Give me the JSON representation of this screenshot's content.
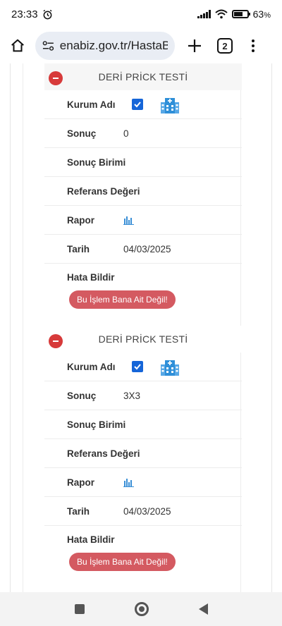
{
  "status_bar": {
    "time": "23:33",
    "battery": "63",
    "battery_unit": "%"
  },
  "browser": {
    "url": "enabiz.gov.tr/HastaBil",
    "tab_count": "2"
  },
  "tests": [
    {
      "title": "DERİ PRİCK TESTİ",
      "fields": {
        "kurum_label": "Kurum Adı",
        "sonuc_label": "Sonuç",
        "sonuc_value": "0",
        "birim_label": "Sonuç Birimi",
        "referans_label": "Referans Değeri",
        "rapor_label": "Rapor",
        "tarih_label": "Tarih",
        "tarih_value": "04/03/2025",
        "hata_label": "Hata Bildir",
        "hata_button": "Bu İşlem Bana Ait Değil!"
      }
    },
    {
      "title": "DERİ PRİCK TESTİ",
      "fields": {
        "kurum_label": "Kurum Adı",
        "sonuc_label": "Sonuç",
        "sonuc_value": "3X3",
        "birim_label": "Sonuç Birimi",
        "referans_label": "Referans Değeri",
        "rapor_label": "Rapor",
        "tarih_label": "Tarih",
        "tarih_value": "04/03/2025",
        "hata_label": "Hata Bildir",
        "hata_button": "Bu İşlem Bana Ait Değil!"
      }
    }
  ],
  "icons": {
    "checkbox": "checkbox-checked-icon",
    "hospital": "hospital-building-icon",
    "report": "bar-chart-icon"
  },
  "colors": {
    "checkbox": "#1565d8",
    "hospital_icon": "#2f8fd8",
    "report_button": "#d45a61",
    "collapse": "#d73a3a"
  }
}
